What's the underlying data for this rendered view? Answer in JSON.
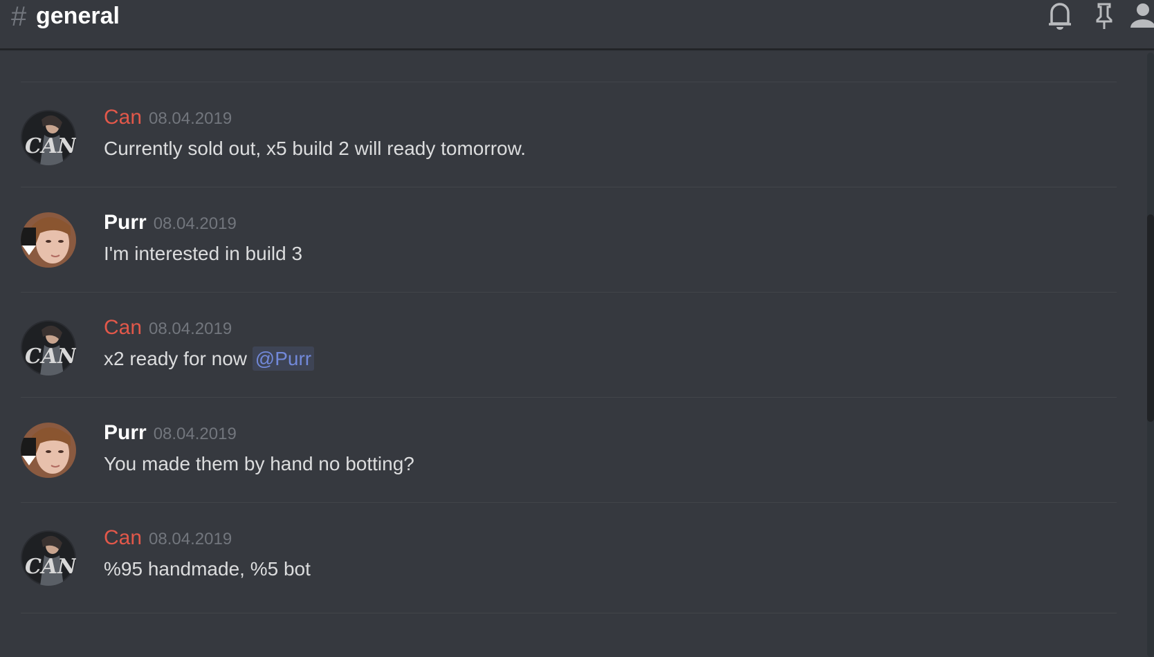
{
  "header": {
    "hash": "#",
    "channel": "general",
    "icons": [
      "bell-icon",
      "pin-icon",
      "members-icon"
    ]
  },
  "colors": {
    "background": "#36393f",
    "can_name": "#e2584a",
    "purr_name": "#ffffff",
    "mention": "#7289da",
    "timestamp": "#72767d"
  },
  "messages": [
    {
      "author": "Can",
      "timestamp": "08.04.2019",
      "text": "Currently sold out, x5 build 2 will ready tomorrow."
    },
    {
      "author": "Purr",
      "timestamp": "08.04.2019",
      "text": "I'm interested in build 3"
    },
    {
      "author": "Can",
      "timestamp": "08.04.2019",
      "text": "x2 ready for now",
      "mention": "@Purr"
    },
    {
      "author": "Purr",
      "timestamp": "08.04.2019",
      "text": "You made them by hand no botting?"
    },
    {
      "author": "Can",
      "timestamp": "08.04.2019",
      "text": "%95 handmade, %5 bot"
    }
  ]
}
